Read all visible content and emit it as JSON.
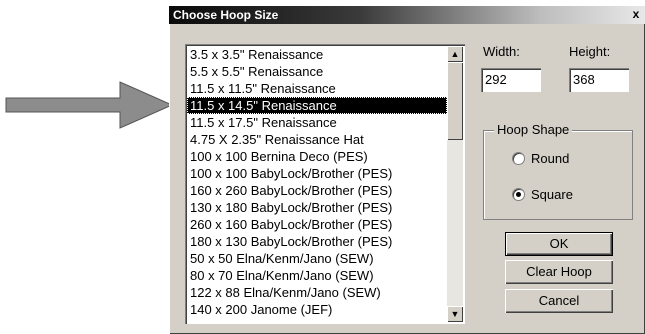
{
  "dialog": {
    "title": "Choose Hoop Size",
    "close_glyph": "x"
  },
  "hoop_list": {
    "selected_index": 3,
    "items": [
      "3.5 x 3.5\" Renaissance",
      "5.5 x 5.5\" Renaissance",
      "11.5 x 11.5\" Renaissance",
      "11.5 x 14.5\" Renaissance",
      "11.5 x 17.5\" Renaissance",
      "4.75 X 2.35\" Renaissance Hat",
      "100 x 100 Bernina Deco (PES)",
      "100 x 100 BabyLock/Brother (PES)",
      "160 x 260 BabyLock/Brother (PES)",
      "130 x 180 BabyLock/Brother (PES)",
      "260 x 160 BabyLock/Brother (PES)",
      "180 x 130 BabyLock/Brother (PES)",
      "50 x 50 Elna/Kenm/Jano (SEW)",
      "80 x 70 Elna/Kenm/Jano (SEW)",
      "122 x 88 Elna/Kenm/Jano (SEW)",
      "140 x 200 Janome (JEF)"
    ]
  },
  "size": {
    "width_label": "Width:",
    "height_label": "Height:",
    "width_value": "292",
    "height_value": "368"
  },
  "hoop_shape": {
    "legend": "Hoop Shape",
    "round_label": "Round",
    "square_label": "Square",
    "selected": "Square"
  },
  "buttons": {
    "ok": "OK",
    "clear_hoop": "Clear Hoop",
    "cancel": "Cancel"
  },
  "colors": {
    "dialog_face": "#d4d0c8",
    "selection": "#000000",
    "arrow": "#8c8c8c"
  }
}
